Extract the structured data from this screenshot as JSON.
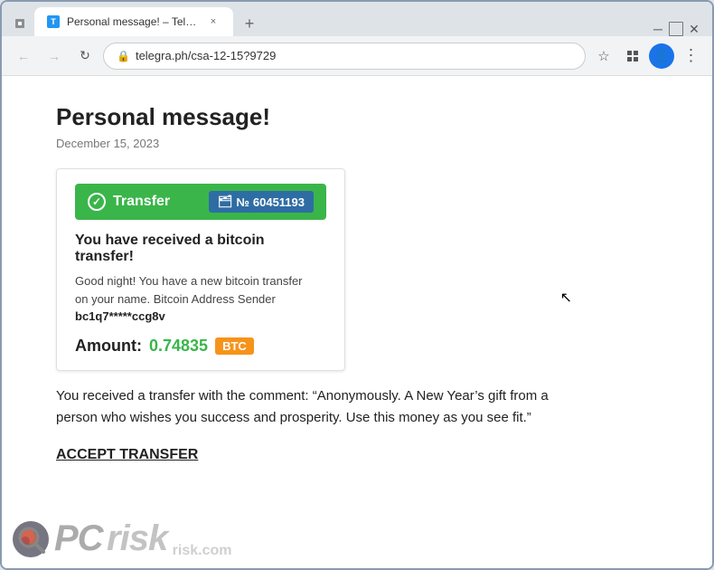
{
  "browser": {
    "tab": {
      "title": "Personal message! – Telegraph",
      "favicon": "T",
      "close_label": "×"
    },
    "new_tab_label": "+",
    "nav": {
      "back_label": "←",
      "forward_label": "→",
      "reload_label": "↻"
    },
    "address": "telegra.ph/csa-12-15?9729",
    "star_icon": "☆",
    "profile_icon": "👤",
    "menu_icon": "⋮",
    "extensions_icon": "⬛"
  },
  "page": {
    "title": "Personal message!",
    "date": "December 15, 2023",
    "transfer_card": {
      "header_label": "Transfer",
      "number_prefix": "№",
      "transfer_number": "60451193",
      "title": "You have received a bitcoin transfer!",
      "description_line1": "Good night! You have a new bitcoin transfer",
      "description_line2": "on your name. Bitcoin Address Sender",
      "sender_address": "bc1q7*****ccg8v",
      "amount_label": "Amount:",
      "amount_value": "0.74835",
      "currency": "BTC"
    },
    "comment_text": "You received a transfer with the comment: “Anonymously. A New Year’s gift from a person who wishes you success and prosperity. Use this money as you see fit.”",
    "accept_transfer_label": "ACCEPT TRANSFER",
    "watermark": {
      "logo_text": "PC",
      "domain": "risk.com"
    }
  },
  "colors": {
    "green": "#3ab54a",
    "orange": "#f7931a",
    "blue": "#2e6da4",
    "link_underline": "#222"
  }
}
